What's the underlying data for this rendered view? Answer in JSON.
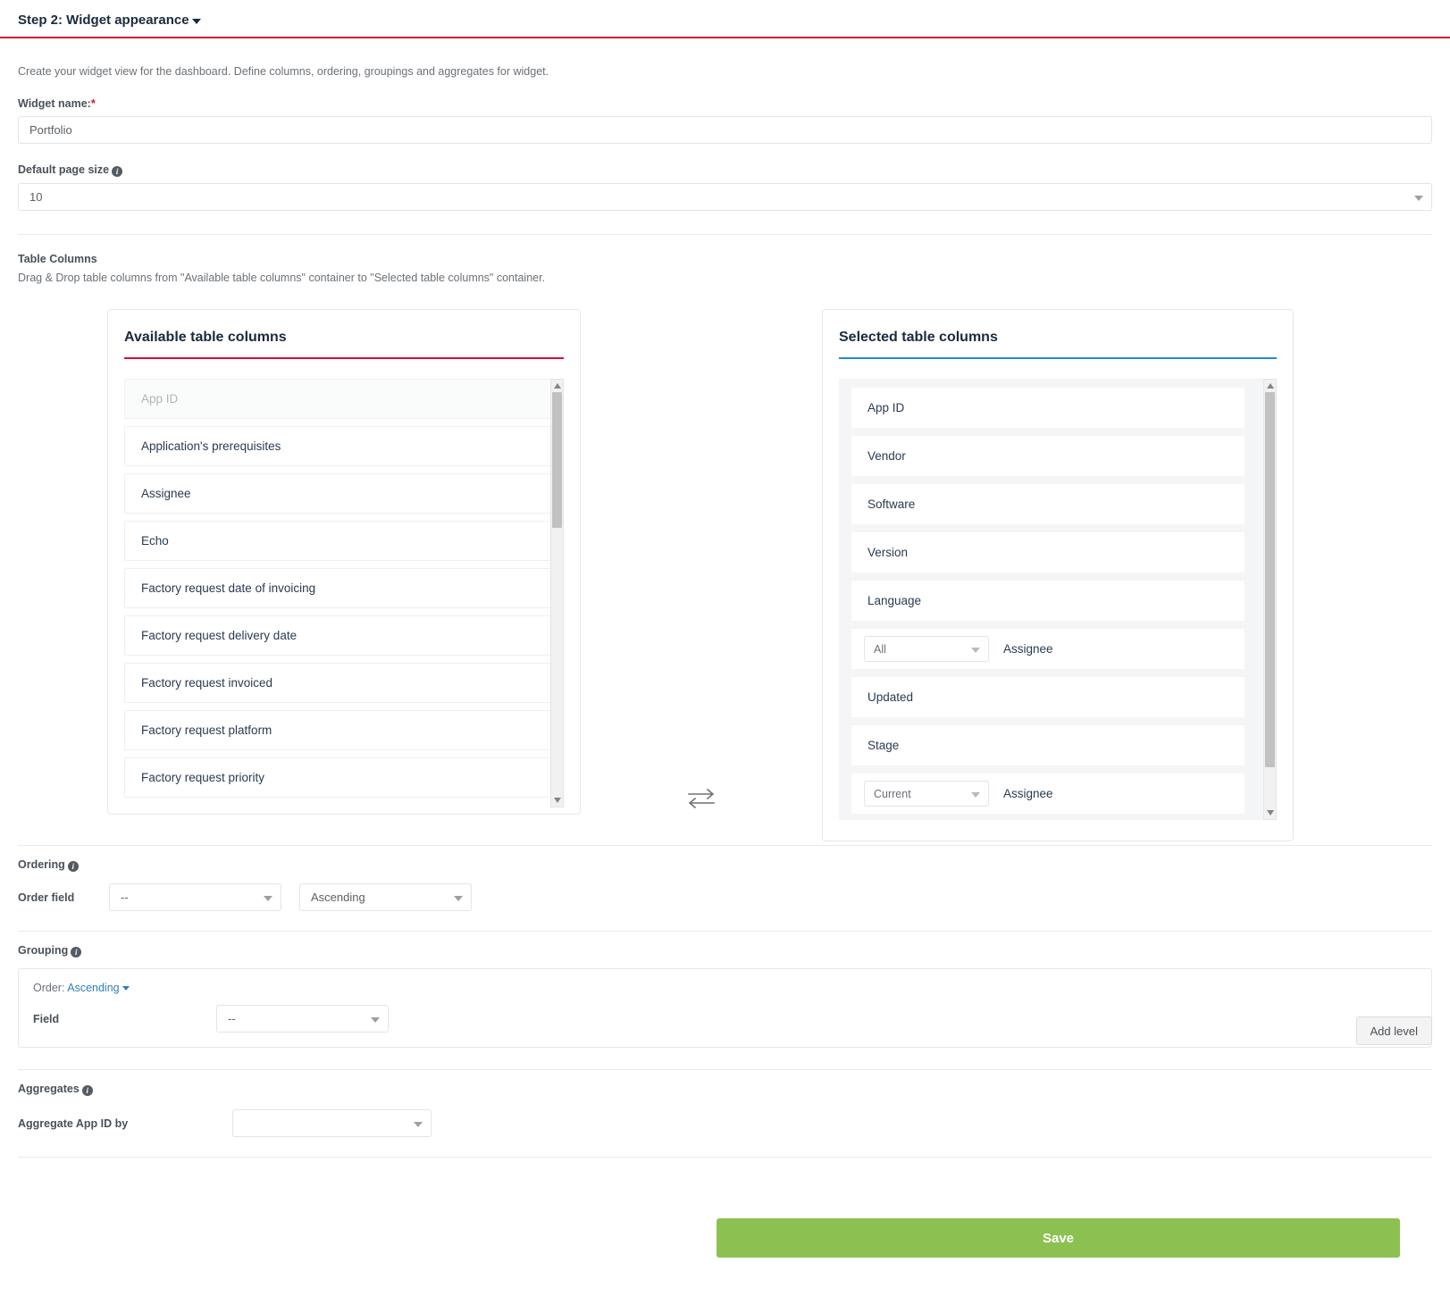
{
  "step": {
    "title": "Step 2: Widget appearance",
    "caret_icon": "caret-down-icon",
    "description": "Create your widget view for the dashboard. Define columns, ordering, groupings and aggregates for widget."
  },
  "widget_name": {
    "label": "Widget name:",
    "required_mark": "*",
    "value": "Portfolio",
    "placeholder": "Portfolio"
  },
  "page_size": {
    "label": "Default page size",
    "info_icon": "info-icon",
    "value": "10"
  },
  "table_columns": {
    "title": "Table Columns",
    "description": "Drag & Drop table columns from \"Available table columns\" container to \"Selected table columns\" container.",
    "transfer_icon": "transfer-arrows-icon",
    "available": {
      "title": "Available table columns",
      "accent_color": "#d0103a",
      "items": [
        {
          "label": "App ID",
          "disabled": true
        },
        {
          "label": "Application's prerequisites",
          "disabled": false
        },
        {
          "label": "Assignee",
          "disabled": false
        },
        {
          "label": "Echo",
          "disabled": false
        },
        {
          "label": "Factory request date of invoicing",
          "disabled": false
        },
        {
          "label": "Factory request delivery date",
          "disabled": false
        },
        {
          "label": "Factory request invoiced",
          "disabled": false
        },
        {
          "label": "Factory request platform",
          "disabled": false
        },
        {
          "label": "Factory request priority",
          "disabled": false
        }
      ]
    },
    "selected": {
      "title": "Selected table columns",
      "accent_color": "#1f8bd0",
      "items": [
        {
          "label": "App ID",
          "select_value": null
        },
        {
          "label": "Vendor",
          "select_value": null
        },
        {
          "label": "Software",
          "select_value": null
        },
        {
          "label": "Version",
          "select_value": null
        },
        {
          "label": "Language",
          "select_value": null
        },
        {
          "label": "Assignee",
          "select_value": "All"
        },
        {
          "label": "Updated",
          "select_value": null
        },
        {
          "label": "Stage",
          "select_value": null
        },
        {
          "label": "Assignee",
          "select_value": "Current"
        }
      ]
    }
  },
  "ordering": {
    "label": "Ordering",
    "info_icon": "info-icon",
    "field_label": "Order field",
    "field_value": "--",
    "direction_value": "Ascending"
  },
  "grouping": {
    "label": "Grouping",
    "info_icon": "info-icon",
    "add_level_label": "Add level",
    "order_prefix": "Order:",
    "order_value": "Ascending",
    "field_label": "Field",
    "field_value": "--"
  },
  "aggregates": {
    "label": "Aggregates",
    "info_icon": "info-icon",
    "row_label": "Aggregate App ID by",
    "value": ""
  },
  "footer": {
    "save_label": "Save",
    "save_color": "#8cc152"
  }
}
